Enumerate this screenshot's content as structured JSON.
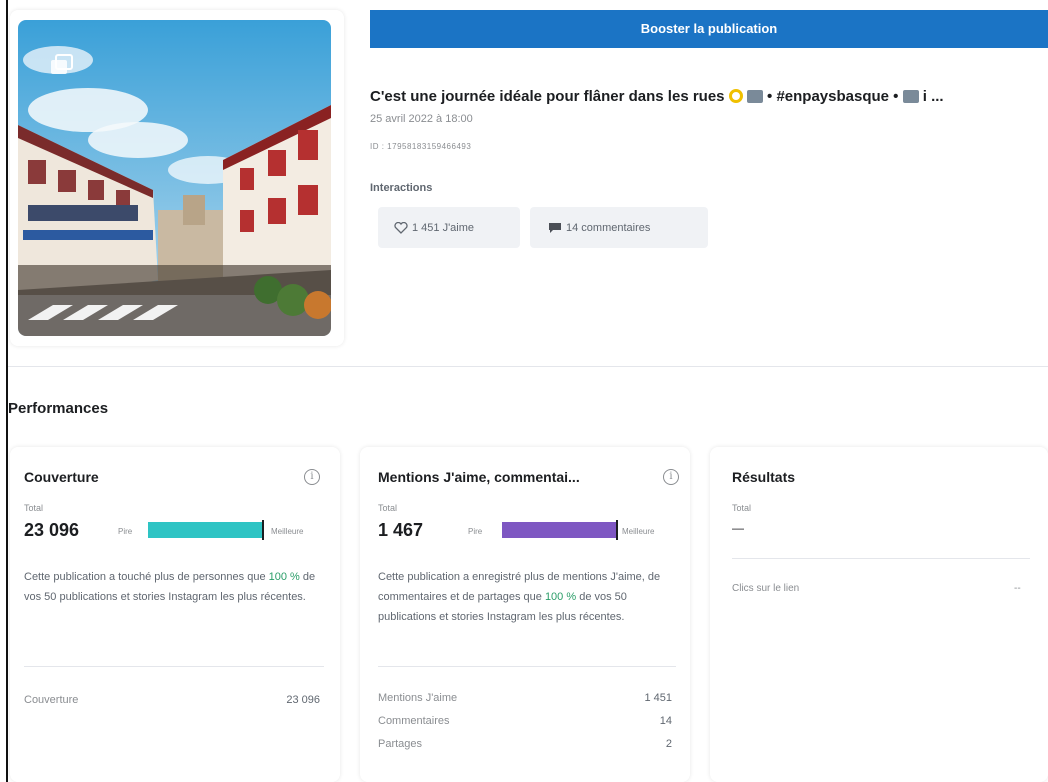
{
  "post": {
    "boost_label": "Booster la publication",
    "title": "C'est une journée idéale pour flâner dans les rues",
    "title_hashtag": " • #enpaysbasque • ",
    "title_ellipsis": " i ...",
    "date": "25 avril 2022 à 18:00",
    "id": "ID : 17958183159466493",
    "interactions_label": "Interactions",
    "likes_label": "1 451 J'aime",
    "comments_label": "14 commentaires"
  },
  "performances": {
    "title": "Performances",
    "cards": [
      {
        "title": "Couverture",
        "total_label": "Total",
        "total_value": "23 096",
        "scale_low": "Pire",
        "scale_high": "Meilleure",
        "bar_color": "#2ec4c4",
        "bar_fraction": 1.0,
        "desc_before": "Cette publication a touché plus de personnes que ",
        "desc_percent": "100 %",
        "desc_after": " de vos 50 publications et stories Instagram les plus récentes.",
        "rows": [
          {
            "label": "Couverture",
            "value": "23 096"
          }
        ]
      },
      {
        "title": "Mentions J'aime, commentai...",
        "total_label": "Total",
        "total_value": "1 467",
        "scale_low": "Pire",
        "scale_high": "Meilleure",
        "bar_color": "#7e57c2",
        "bar_fraction": 1.0,
        "desc_before": "Cette publication a enregistré plus de mentions J'aime, de commentaires et de partages que ",
        "desc_percent": "100 %",
        "desc_after": " de vos 50 publications et stories Instagram les plus récentes.",
        "rows": [
          {
            "label": "Mentions J'aime",
            "value": "1 451"
          },
          {
            "label": "Commentaires",
            "value": "14"
          },
          {
            "label": "Partages",
            "value": "2"
          }
        ]
      },
      {
        "title": "Résultats",
        "total_label": "Total",
        "total_value": "—",
        "click_hint": "Clics sur le lien",
        "click_value": "--"
      }
    ]
  },
  "colors": {
    "boost_blue": "#1b74c5",
    "highlight_green": "#2a9d68",
    "reach_bar": "#2ec4c4",
    "engagement_bar": "#7e57c2"
  },
  "icons": {
    "carousel": "carousel-icon",
    "like": "heart-icon",
    "comment": "comment-bubble-icon",
    "info": "info-icon"
  }
}
